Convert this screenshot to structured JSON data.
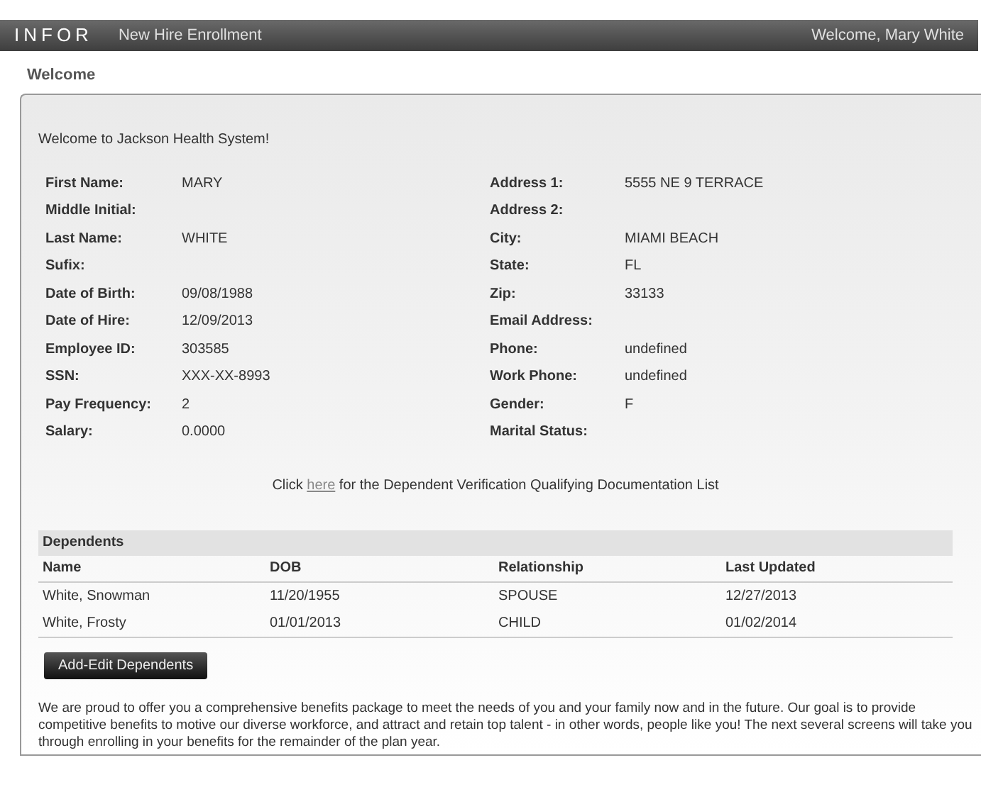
{
  "header": {
    "logo": "INFOR",
    "app_title": "New Hire Enrollment",
    "greeting": "Welcome, Mary White"
  },
  "page_title": "Welcome",
  "intro": "Welcome to Jackson Health System!",
  "fields_left": [
    {
      "label": "First Name:",
      "value": "MARY"
    },
    {
      "label": "Middle Initial:"
    },
    {
      "label": "Last Name:",
      "value": "WHITE"
    },
    {
      "label": "Sufix:"
    },
    {
      "label": "Date of Birth:",
      "value": "09/08/1988"
    },
    {
      "label": "Date of Hire:",
      "value": "12/09/2013"
    },
    {
      "label": "Employee ID:",
      "value": "303585"
    },
    {
      "label": "SSN:",
      "value": "XXX-XX-8993"
    },
    {
      "label": "Pay Frequency:",
      "value": "2"
    },
    {
      "label": "Salary:",
      "value": "0.0000"
    }
  ],
  "fields_right": [
    {
      "label": "Address 1:",
      "value": "5555 NE 9 TERRACE"
    },
    {
      "label": "Address 2:"
    },
    {
      "label": "City:",
      "value": "MIAMI BEACH"
    },
    {
      "label": "State:",
      "value": "FL"
    },
    {
      "label": "Zip:",
      "value": "33133"
    },
    {
      "label": "Email Address:"
    },
    {
      "label": "Phone:",
      "value": "undefined"
    },
    {
      "label": "Work Phone:",
      "value": "undefined"
    },
    {
      "label": "Gender:",
      "value": "F"
    },
    {
      "label": "Marital Status:"
    }
  ],
  "doc_line": {
    "before": "Click",
    "link": "here",
    "after": "for the Dependent Verification Qualifying Documentation List"
  },
  "dependents": {
    "title": "Dependents",
    "columns": [
      "Name",
      "DOB",
      "Relationship",
      "Last Updated"
    ],
    "rows": [
      [
        "White, Snowman",
        "11/20/1955",
        "SPOUSE",
        "12/27/2013"
      ],
      [
        "White, Frosty",
        "01/01/2013",
        "CHILD",
        "01/02/2014"
      ]
    ]
  },
  "button": "Add-Edit Dependents",
  "closing": "We are proud to offer you a comprehensive benefits package to meet the needs of you and your family now and in the future. Our goal is to provide competitive benefits to motive our diverse workforce, and attract and retain top talent - in other words, people like you! The next several screens will take you through enrolling in your benefits for the remainder of the plan year."
}
